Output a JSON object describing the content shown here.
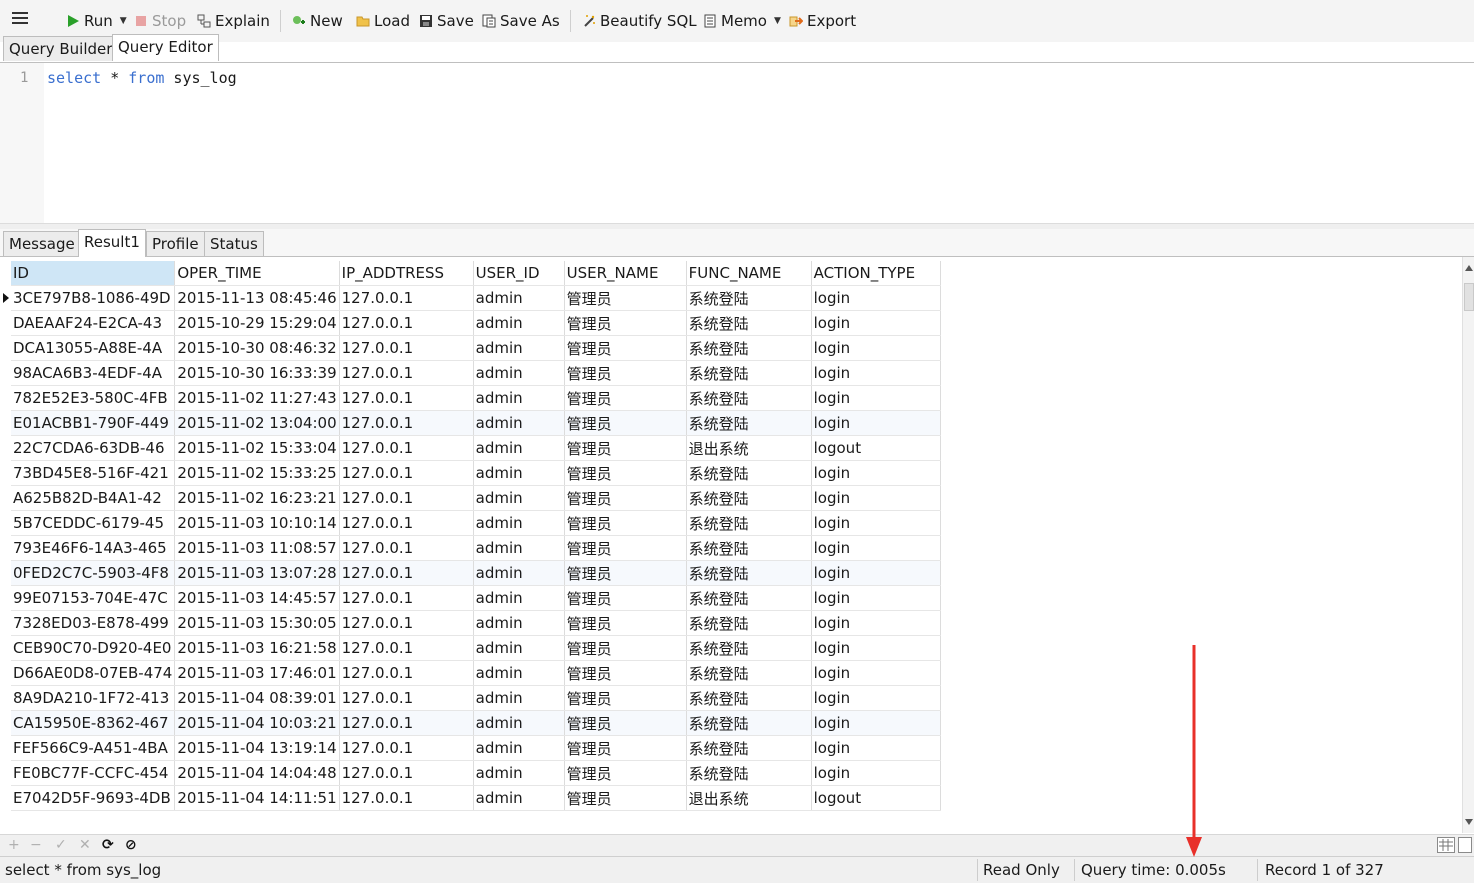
{
  "toolbar": {
    "run": "Run",
    "stop": "Stop",
    "explain": "Explain",
    "new": "New",
    "load": "Load",
    "save": "Save",
    "save_as": "Save As",
    "beautify": "Beautify SQL",
    "memo": "Memo",
    "export": "Export"
  },
  "editor_tabs": [
    "Query Builder",
    "Query Editor"
  ],
  "editor": {
    "line_number": "1",
    "kw_select": "select",
    "star": " * ",
    "kw_from": "from",
    "table": " sys_log"
  },
  "result_tabs": [
    "Message",
    "Result1",
    "Profile",
    "Status"
  ],
  "grid": {
    "columns": [
      "ID",
      "OPER_TIME",
      "IP_ADDTRESS",
      "USER_ID",
      "USER_NAME",
      "FUNC_NAME",
      "ACTION_TYPE"
    ],
    "rows": [
      [
        "3CE797B8-1086-49D",
        "2015-11-13 08:45:46",
        "127.0.0.1",
        "admin",
        "管理员",
        "系统登陆",
        "login"
      ],
      [
        "DAEAAF24-E2CA-43",
        "2015-10-29 15:29:04",
        "127.0.0.1",
        "admin",
        "管理员",
        "系统登陆",
        "login"
      ],
      [
        "DCA13055-A88E-4A",
        "2015-10-30 08:46:32",
        "127.0.0.1",
        "admin",
        "管理员",
        "系统登陆",
        "login"
      ],
      [
        "98ACA6B3-4EDF-4A",
        "2015-10-30 16:33:39",
        "127.0.0.1",
        "admin",
        "管理员",
        "系统登陆",
        "login"
      ],
      [
        "782E52E3-580C-4FB",
        "2015-11-02 11:27:43",
        "127.0.0.1",
        "admin",
        "管理员",
        "系统登陆",
        "login"
      ],
      [
        "E01ACBB1-790F-449",
        "2015-11-02 13:04:00",
        "127.0.0.1",
        "admin",
        "管理员",
        "系统登陆",
        "login"
      ],
      [
        "22C7CDA6-63DB-46",
        "2015-11-02 15:33:04",
        "127.0.0.1",
        "admin",
        "管理员",
        "退出系统",
        "logout"
      ],
      [
        "73BD45E8-516F-421",
        "2015-11-02 15:33:25",
        "127.0.0.1",
        "admin",
        "管理员",
        "系统登陆",
        "login"
      ],
      [
        "A625B82D-B4A1-42",
        "2015-11-02 16:23:21",
        "127.0.0.1",
        "admin",
        "管理员",
        "系统登陆",
        "login"
      ],
      [
        "5B7CEDDC-6179-45",
        "2015-11-03 10:10:14",
        "127.0.0.1",
        "admin",
        "管理员",
        "系统登陆",
        "login"
      ],
      [
        "793E46F6-14A3-465",
        "2015-11-03 11:08:57",
        "127.0.0.1",
        "admin",
        "管理员",
        "系统登陆",
        "login"
      ],
      [
        "0FED2C7C-5903-4F8",
        "2015-11-03 13:07:28",
        "127.0.0.1",
        "admin",
        "管理员",
        "系统登陆",
        "login"
      ],
      [
        "99E07153-704E-47C",
        "2015-11-03 14:45:57",
        "127.0.0.1",
        "admin",
        "管理员",
        "系统登陆",
        "login"
      ],
      [
        "7328ED03-E878-499",
        "2015-11-03 15:30:05",
        "127.0.0.1",
        "admin",
        "管理员",
        "系统登陆",
        "login"
      ],
      [
        "CEB90C70-D920-4E0",
        "2015-11-03 16:21:58",
        "127.0.0.1",
        "admin",
        "管理员",
        "系统登陆",
        "login"
      ],
      [
        "D66AE0D8-07EB-474",
        "2015-11-03 17:46:01",
        "127.0.0.1",
        "admin",
        "管理员",
        "系统登陆",
        "login"
      ],
      [
        "8A9DA210-1F72-413",
        "2015-11-04 08:39:01",
        "127.0.0.1",
        "admin",
        "管理员",
        "系统登陆",
        "login"
      ],
      [
        "CA15950E-8362-467",
        "2015-11-04 10:03:21",
        "127.0.0.1",
        "admin",
        "管理员",
        "系统登陆",
        "login"
      ],
      [
        "FEF566C9-A451-4BA",
        "2015-11-04 13:19:14",
        "127.0.0.1",
        "admin",
        "管理员",
        "系统登陆",
        "login"
      ],
      [
        "FE0BC77F-CCFC-454",
        "2015-11-04 14:04:48",
        "127.0.0.1",
        "admin",
        "管理员",
        "系统登陆",
        "login"
      ],
      [
        "E7042D5F-9693-4DB",
        "2015-11-04 14:11:51",
        "127.0.0.1",
        "admin",
        "管理员",
        "退出系统",
        "logout"
      ]
    ]
  },
  "navbar": {
    "add": "+",
    "delete": "−",
    "apply": "✓",
    "cancel": "✕",
    "refresh": "⟳",
    "stop": "⊘"
  },
  "status": {
    "sql": "select * from sys_log",
    "mode": "Read Only",
    "query_time": "Query time: 0.005s",
    "record": "Record 1 of 327"
  },
  "colors": {
    "keyword": "#3a6fcf",
    "selected_header": "#cfe6f6",
    "arrow": "#e8302a",
    "run_green": "#2aa02a"
  }
}
